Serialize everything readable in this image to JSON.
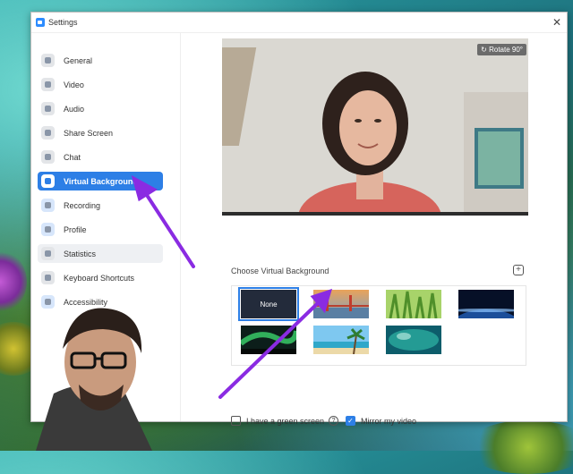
{
  "window": {
    "title": "Settings",
    "close_glyph": "✕"
  },
  "sidebar": {
    "items": [
      {
        "label": "General",
        "icon": "gear-icon",
        "color": "#e3e5e8"
      },
      {
        "label": "Video",
        "icon": "video-icon",
        "color": "#e3e5e8"
      },
      {
        "label": "Audio",
        "icon": "headphones-icon",
        "color": "#e3e5e8"
      },
      {
        "label": "Share Screen",
        "icon": "share-screen-icon",
        "color": "#e3e5e8"
      },
      {
        "label": "Chat",
        "icon": "chat-icon",
        "color": "#e3e5e8"
      },
      {
        "label": "Virtual Background",
        "icon": "person-background-icon",
        "color": "#2d7fe6"
      },
      {
        "label": "Recording",
        "icon": "record-icon",
        "color": "#d7e6fb"
      },
      {
        "label": "Profile",
        "icon": "profile-icon",
        "color": "#d7e6fb"
      },
      {
        "label": "Statistics",
        "icon": "statistics-icon",
        "color": "#e3e5e8"
      },
      {
        "label": "Keyboard Shortcuts",
        "icon": "keyboard-icon",
        "color": "#e3e5e8"
      },
      {
        "label": "Accessibility",
        "icon": "accessibility-icon",
        "color": "#d7e6fb"
      }
    ],
    "active": "Virtual Background"
  },
  "preview": {
    "rotate_label": "Rotate 90°"
  },
  "backgrounds": {
    "section_label": "Choose Virtual Background",
    "add_glyph": "+",
    "none_label": "None",
    "thumbnails": [
      {
        "name": "none"
      },
      {
        "name": "golden-gate-bridge"
      },
      {
        "name": "grass"
      },
      {
        "name": "earth-from-space"
      },
      {
        "name": "northern-lights"
      },
      {
        "name": "beach"
      },
      {
        "name": "underwater"
      }
    ]
  },
  "options": {
    "green_screen": {
      "label": "I have a green screen",
      "checked": false
    },
    "mirror_video": {
      "label": "Mirror my video",
      "checked": true
    },
    "help_glyph": "?"
  },
  "colors": {
    "accent": "#2d7fe6",
    "annotation_arrow": "#8a2be2"
  }
}
